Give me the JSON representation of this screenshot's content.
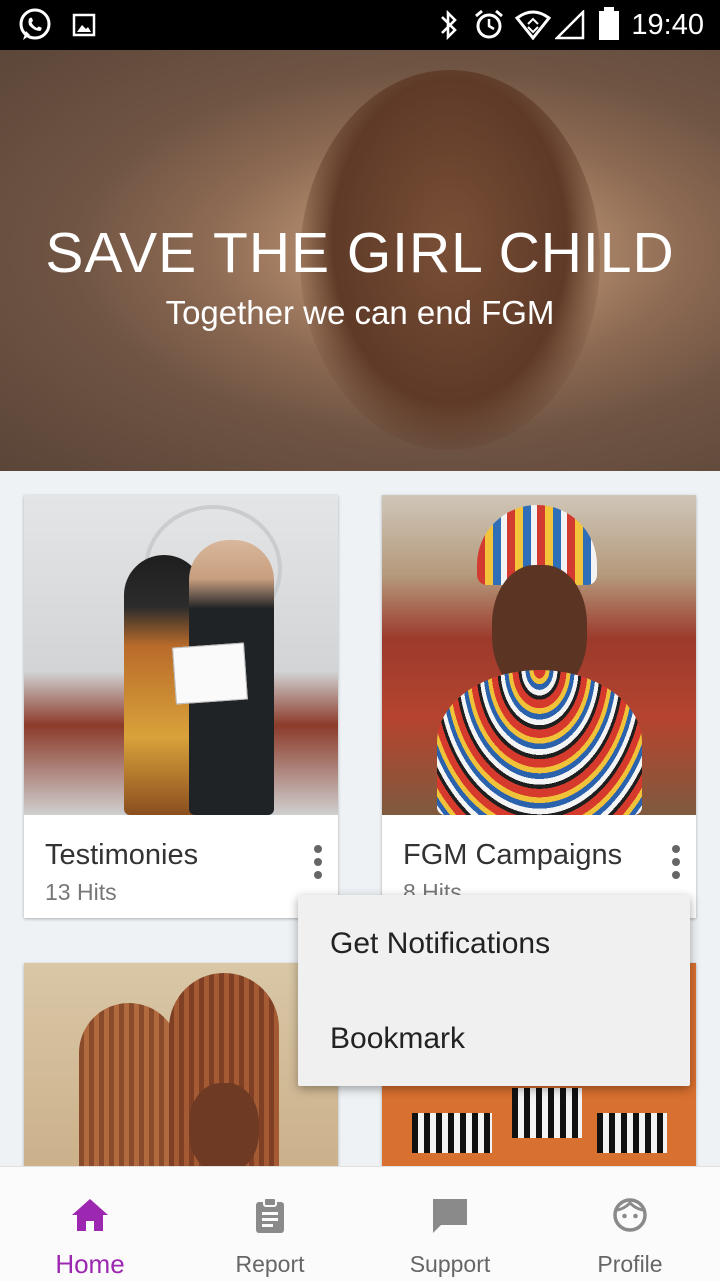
{
  "status_bar": {
    "time": "19:40"
  },
  "hero": {
    "title": "SAVE THE GIRL CHILD",
    "subtitle": "Together we can end FGM"
  },
  "cards": [
    {
      "title": "Testimonies",
      "hits": "13 Hits"
    },
    {
      "title": "FGM Campaigns",
      "hits": "8 Hits"
    }
  ],
  "popup_menu": {
    "items": [
      "Get Notifications",
      "Bookmark"
    ]
  },
  "bottom_nav": {
    "items": [
      "Home",
      "Report",
      "Support",
      "Profile"
    ],
    "active": "Home"
  },
  "colors": {
    "accent": "#9c27b0",
    "inactive_icon": "#8a8a8a"
  }
}
